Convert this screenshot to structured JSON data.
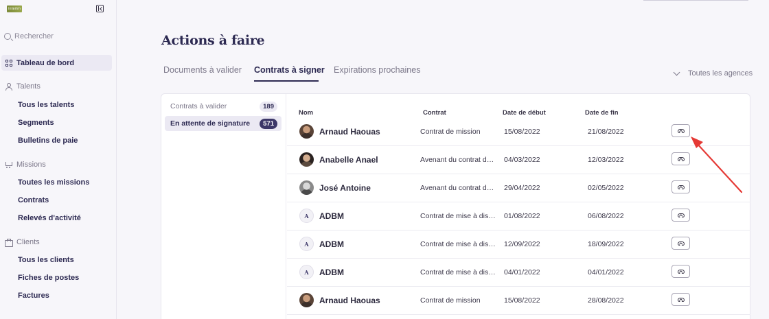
{
  "sidebar": {
    "logo_text": "interim",
    "search_placeholder": "Rechercher",
    "dashboard_label": "Tableau de bord",
    "sections": {
      "talents": {
        "label": "Talents",
        "items": [
          "Tous les talents",
          "Segments",
          "Bulletins de paie"
        ]
      },
      "missions": {
        "label": "Missions",
        "items": [
          "Toutes les missions",
          "Contrats",
          "Relevés d'activité"
        ]
      },
      "clients": {
        "label": "Clients",
        "items": [
          "Tous les clients",
          "Fiches de postes",
          "Factures"
        ]
      }
    }
  },
  "main": {
    "title": "Actions à faire",
    "tabs": [
      "Documents à valider",
      "Contrats à signer",
      "Expirations prochaines"
    ],
    "active_tab": "Contrats à signer",
    "agency_filter": "Toutes les agences"
  },
  "filters": [
    {
      "label": "Contrats à valider",
      "count": "189"
    },
    {
      "label": "En attente de signature",
      "count": "571"
    }
  ],
  "table": {
    "columns": [
      "Nom",
      "Contrat",
      "Date de début",
      "Date de fin"
    ],
    "rows": [
      {
        "name": "Arnaud Haouas",
        "contract": "Contrat de mission",
        "start": "15/08/2022",
        "end": "21/08/2022",
        "avatar": "photo"
      },
      {
        "name": "Anabelle Anael",
        "contract": "Avenant du contrat de mission",
        "start": "04/03/2022",
        "end": "12/03/2022",
        "avatar": "photo2"
      },
      {
        "name": "José Antoine",
        "contract": "Avenant du contrat de mission",
        "start": "29/04/2022",
        "end": "02/05/2022",
        "avatar": "bw"
      },
      {
        "name": "ADBM",
        "contract": "Contrat de mise à disposition",
        "start": "01/08/2022",
        "end": "06/08/2022",
        "avatar": "letter",
        "initial": "A"
      },
      {
        "name": "ADBM",
        "contract": "Contrat de mise à disposition",
        "start": "12/09/2022",
        "end": "18/09/2022",
        "avatar": "letter",
        "initial": "A"
      },
      {
        "name": "ADBM",
        "contract": "Contrat de mise à disposition",
        "start": "04/01/2022",
        "end": "04/01/2022",
        "avatar": "letter",
        "initial": "A"
      },
      {
        "name": "Arnaud Haouas",
        "contract": "Contrat de mission",
        "start": "15/08/2022",
        "end": "28/08/2022",
        "avatar": "photo"
      }
    ]
  },
  "colors": {
    "accent": "#2d2a52",
    "badge_active": "#3c3768",
    "annotation_arrow": "#e53935"
  }
}
